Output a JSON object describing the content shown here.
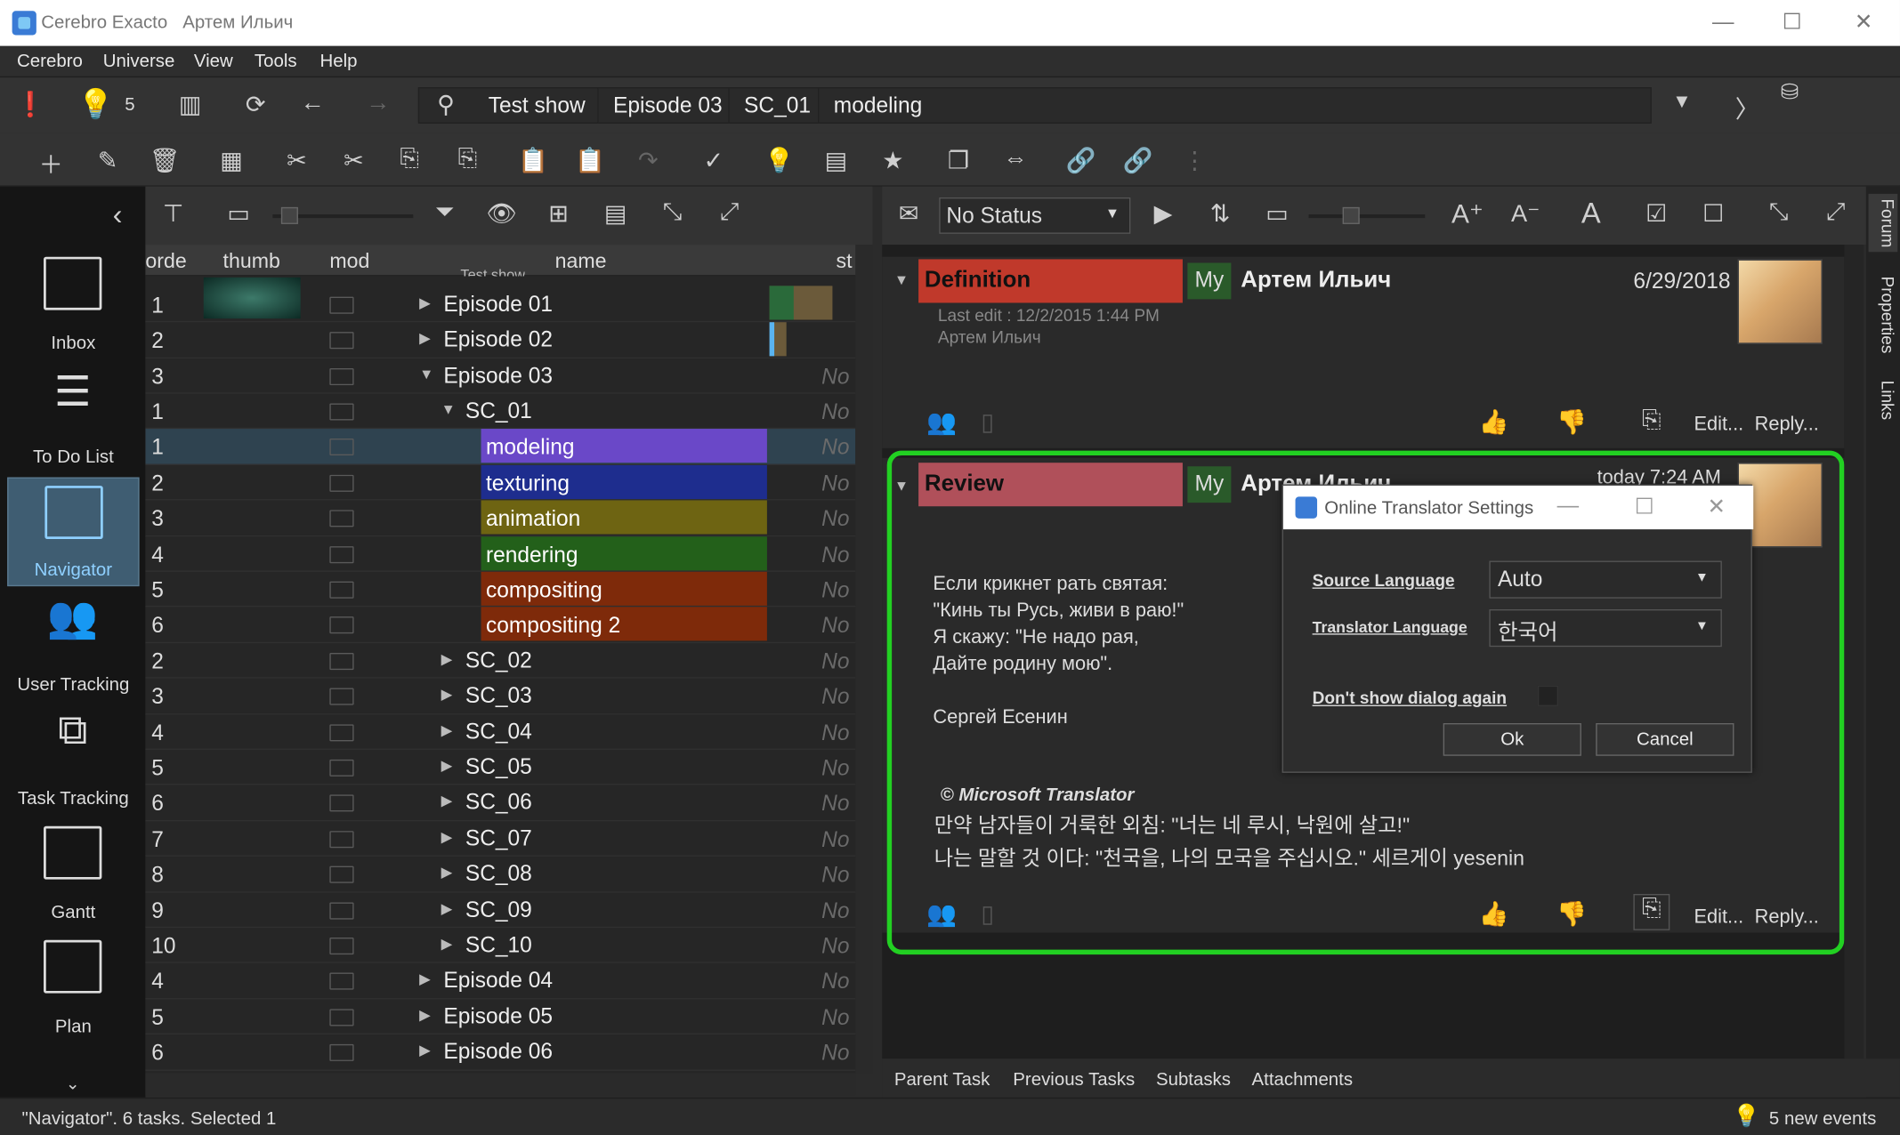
{
  "window": {
    "app_name": "Cerebro Exacto",
    "user": "Артем Ильич",
    "min": "—",
    "max": "☐",
    "close": "✕"
  },
  "menu": [
    "Cerebro",
    "Universe",
    "View",
    "Tools",
    "Help"
  ],
  "toolbar": {
    "bulb_count": "5",
    "breadcrumbs": [
      "Test show",
      "Episode 03",
      "SC_01",
      "modeling"
    ]
  },
  "sidebar": {
    "items": [
      {
        "label": "Inbox",
        "icon": "inbox-icon"
      },
      {
        "label": "To Do List",
        "icon": "todo-list-icon"
      },
      {
        "label": "Navigator",
        "icon": "folder-icon",
        "selected": true
      },
      {
        "label": "User Tracking",
        "icon": "user-tracking-icon"
      },
      {
        "label": "Task Tracking",
        "icon": "task-tracking-icon"
      },
      {
        "label": "Gantt",
        "icon": "gantt-icon"
      },
      {
        "label": "Plan",
        "icon": "plan-icon"
      }
    ]
  },
  "tree": {
    "columns": {
      "order": "orde",
      "thumb": "thumb",
      "mod": "mod",
      "name": "name",
      "status": "st"
    },
    "partial_header_row": "Test show",
    "status_placeholder": "No",
    "rows": [
      {
        "ord": "1",
        "name": "Episode 01",
        "level": 0,
        "expander": "▶"
      },
      {
        "ord": "2",
        "name": "Episode 02",
        "level": 0,
        "expander": "▶"
      },
      {
        "ord": "3",
        "name": "Episode 03",
        "level": 0,
        "expander": "▼"
      },
      {
        "ord": "1",
        "name": "SC_01",
        "level": 1,
        "expander": "▼"
      },
      {
        "ord": "1",
        "name": "modeling",
        "level": 2,
        "color": "#6a48c8",
        "selected": true
      },
      {
        "ord": "2",
        "name": "texturing",
        "level": 2,
        "color": "#1e2d8e"
      },
      {
        "ord": "3",
        "name": "animation",
        "level": 2,
        "color": "#6e6412"
      },
      {
        "ord": "4",
        "name": "rendering",
        "level": 2,
        "color": "#23601a"
      },
      {
        "ord": "5",
        "name": "compositing",
        "level": 2,
        "color": "#7e2a0a"
      },
      {
        "ord": "6",
        "name": "compositing 2",
        "level": 2,
        "color": "#7e2a0a"
      },
      {
        "ord": "2",
        "name": "SC_02",
        "level": 1,
        "expander": "▶"
      },
      {
        "ord": "3",
        "name": "SC_03",
        "level": 1,
        "expander": "▶"
      },
      {
        "ord": "4",
        "name": "SC_04",
        "level": 1,
        "expander": "▶"
      },
      {
        "ord": "5",
        "name": "SC_05",
        "level": 1,
        "expander": "▶"
      },
      {
        "ord": "6",
        "name": "SC_06",
        "level": 1,
        "expander": "▶"
      },
      {
        "ord": "7",
        "name": "SC_07",
        "level": 1,
        "expander": "▶"
      },
      {
        "ord": "8",
        "name": "SC_08",
        "level": 1,
        "expander": "▶"
      },
      {
        "ord": "9",
        "name": "SC_09",
        "level": 1,
        "expander": "▶"
      },
      {
        "ord": "10",
        "name": "SC_10",
        "level": 1,
        "expander": "▶"
      },
      {
        "ord": "4",
        "name": "Episode 04",
        "level": 0,
        "expander": "▶"
      },
      {
        "ord": "5",
        "name": "Episode 05",
        "level": 0,
        "expander": "▶"
      },
      {
        "ord": "6",
        "name": "Episode 06",
        "level": 0,
        "expander": "▶"
      }
    ]
  },
  "forum_toolbar": {
    "status": "No Status"
  },
  "posts": {
    "definition": {
      "type": "Definition",
      "type_color": "#c0392b",
      "my": "My",
      "author": "Артем Ильич",
      "date": "6/29/2018",
      "last_edit": "Last edit : 12/2/2015 1:44 PM",
      "editor": "Артем Ильич",
      "edit": "Edit...",
      "reply": "Reply..."
    },
    "review": {
      "type": "Review",
      "type_color": "#b0505a",
      "my": "My",
      "author": "Артем Ильич",
      "date": "today 7:24 AM",
      "body": [
        "Если крикнет рать святая:",
        "\"Кинь ты Русь, живи в раю!\"",
        "Я скажу: \"Не надо рая,",
        "Дайте родину мою\".",
        "",
        "Сергей Есенин"
      ],
      "translator_credit": "© Microsoft Translator",
      "translation": [
        "만약 남자들이 거룩한 외침: \"너는 네 루시, 낙원에 살고!\"",
        "나는 말할 것 이다: \"천국을, 나의 모국을 주십시오.\" 세르게이 yesenin"
      ],
      "edit": "Edit...",
      "reply": "Reply..."
    }
  },
  "right_tabs": [
    "Forum",
    "Properties",
    "Links"
  ],
  "bottom_tabs": [
    "Parent Task",
    "Previous Tasks",
    "Subtasks",
    "Attachments"
  ],
  "statusbar": {
    "text": "\"Navigator\". 6 tasks. Selected 1",
    "events": "5 new events"
  },
  "dialog": {
    "title": "Online Translator Settings",
    "source_label": "Source Language",
    "source_value": "Auto",
    "target_label": "Translator Language",
    "target_value": "한국어",
    "dont_show_label": "Don't show dialog again",
    "ok": "Ok",
    "cancel": "Cancel"
  },
  "highlight_color": "#22d022"
}
